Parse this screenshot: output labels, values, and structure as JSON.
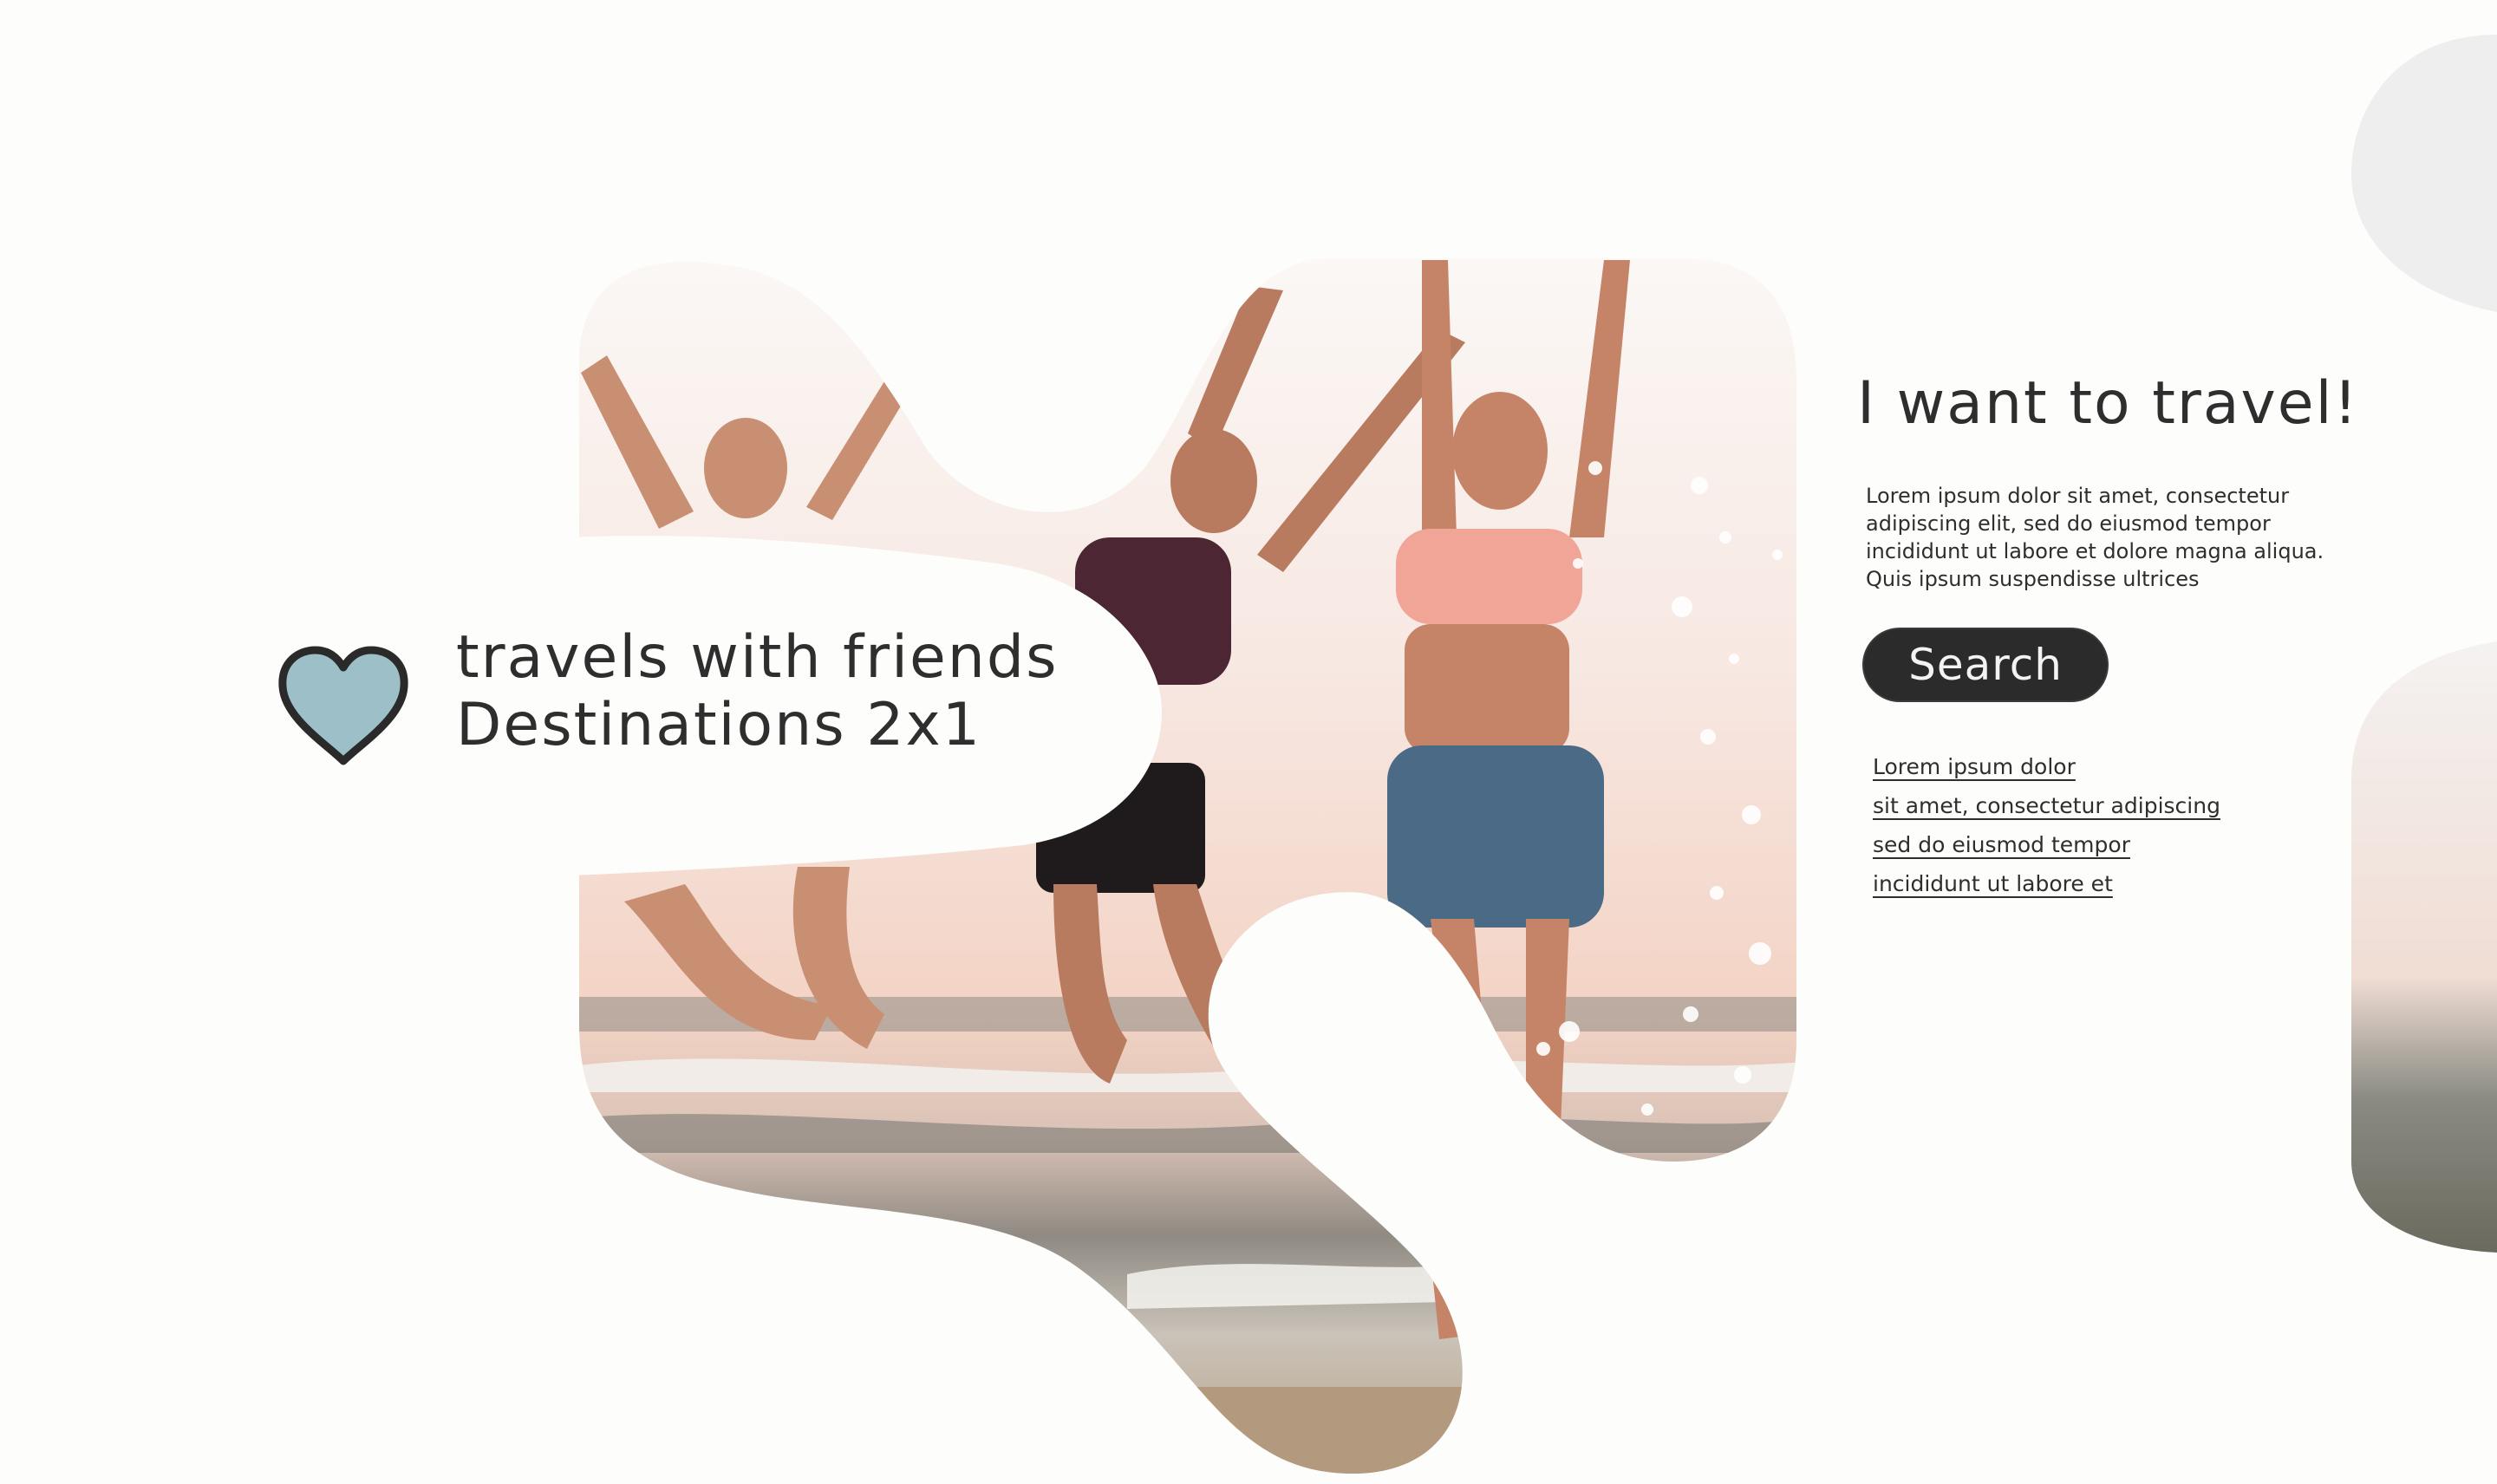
{
  "hero": {
    "line1": "travels with friends",
    "line2": "Destinations 2x1"
  },
  "panel": {
    "title": "I want to travel!",
    "body": "Lorem ipsum dolor sit amet, consectetur adipiscing elit, sed do eiusmod tempor incididunt ut labore et dolore magna aliqua. Quis ipsum suspendisse ultrices",
    "search_label": "Search",
    "links": [
      "Lorem ipsum dolor",
      "sit amet, consectetur adipiscing",
      "sed do eiusmod tempor",
      "incididunt ut labore et"
    ]
  },
  "icons": {
    "heart": "heart-icon"
  },
  "colors": {
    "background": "#fdfdfc",
    "heart_fill": "#9dc0c8",
    "heart_stroke": "#2a2a2a",
    "button_bg": "#2b2b2b",
    "text": "#2e2e2e"
  }
}
